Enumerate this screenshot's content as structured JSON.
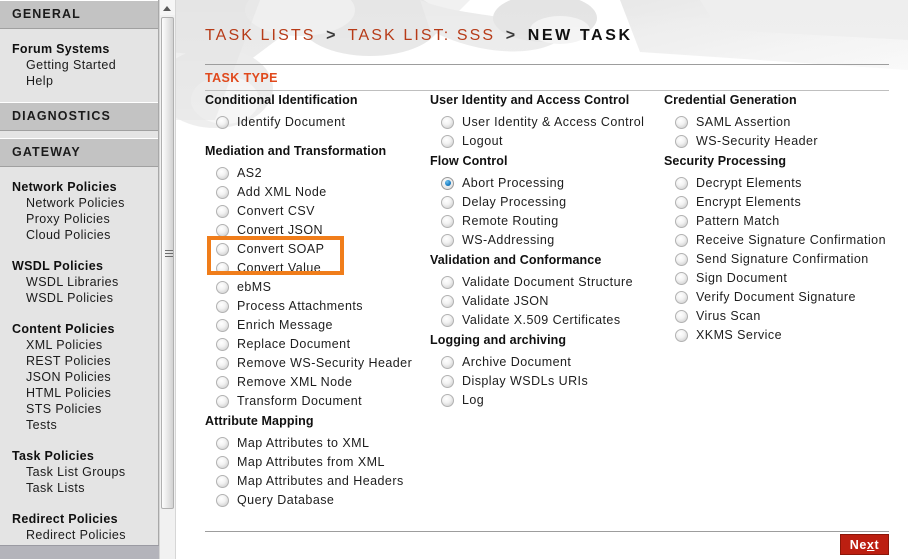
{
  "sidebar": {
    "sections": [
      {
        "header": "GENERAL",
        "groups": [
          {
            "title": "Forum Systems",
            "links": [
              "Getting Started",
              "Help"
            ]
          }
        ]
      },
      {
        "header": "DIAGNOSTICS",
        "groups": []
      },
      {
        "header": "GATEWAY",
        "groups": [
          {
            "title": "Network Policies",
            "links": [
              "Network Policies",
              "Proxy Policies",
              "Cloud Policies"
            ]
          },
          {
            "title": "WSDL Policies",
            "links": [
              "WSDL Libraries",
              "WSDL Policies"
            ]
          },
          {
            "title": "Content Policies",
            "links": [
              "XML Policies",
              "REST Policies",
              "JSON Policies",
              "HTML Policies",
              "STS Policies",
              "Tests"
            ]
          },
          {
            "title": "Task Policies",
            "links": [
              "Task List Groups",
              "Task Lists"
            ]
          },
          {
            "title": "Redirect Policies",
            "links": [
              "Redirect Policies"
            ]
          }
        ]
      }
    ]
  },
  "breadcrumb": {
    "items": [
      "TASK LISTS",
      "TASK LIST: SSS"
    ],
    "separator": ">",
    "current": "NEW TASK"
  },
  "section": {
    "title": "TASK TYPE"
  },
  "columns": [
    {
      "groups": [
        {
          "title": "Conditional Identification",
          "options": [
            {
              "label": "Identify Document",
              "selected": false
            }
          ]
        },
        {
          "title": "Mediation and Transformation",
          "options": [
            {
              "label": "AS2",
              "selected": false
            },
            {
              "label": "Add XML Node",
              "selected": false
            },
            {
              "label": "Convert CSV",
              "selected": false
            },
            {
              "label": "Convert JSON",
              "selected": false
            },
            {
              "label": "Convert SOAP",
              "selected": false
            },
            {
              "label": "Convert Value",
              "selected": false
            },
            {
              "label": "ebMS",
              "selected": false
            },
            {
              "label": "Process Attachments",
              "selected": false
            },
            {
              "label": "Enrich Message",
              "selected": false
            },
            {
              "label": "Replace Document",
              "selected": false
            },
            {
              "label": "Remove WS-Security Header",
              "selected": false
            },
            {
              "label": "Remove XML Node",
              "selected": false
            },
            {
              "label": "Transform Document",
              "selected": false
            }
          ]
        },
        {
          "title": "Attribute Mapping",
          "options": [
            {
              "label": "Map Attributes to XML",
              "selected": false
            },
            {
              "label": "Map Attributes from XML",
              "selected": false
            },
            {
              "label": "Map Attributes and Headers",
              "selected": false
            },
            {
              "label": "Query Database",
              "selected": false
            }
          ]
        }
      ]
    },
    {
      "groups": [
        {
          "title": "User Identity and Access Control",
          "options": [
            {
              "label": "User Identity & Access Control",
              "selected": false
            },
            {
              "label": "Logout",
              "selected": false
            }
          ]
        },
        {
          "title": "Flow Control",
          "options": [
            {
              "label": "Abort Processing",
              "selected": true
            },
            {
              "label": "Delay Processing",
              "selected": false
            },
            {
              "label": "Remote Routing",
              "selected": false
            },
            {
              "label": "WS-Addressing",
              "selected": false
            }
          ]
        },
        {
          "title": "Validation and Conformance",
          "options": [
            {
              "label": "Validate Document Structure",
              "selected": false
            },
            {
              "label": "Validate JSON",
              "selected": false
            },
            {
              "label": "Validate X.509 Certificates",
              "selected": false
            }
          ]
        },
        {
          "title": "Logging and archiving",
          "options": [
            {
              "label": "Archive Document",
              "selected": false
            },
            {
              "label": "Display WSDLs URIs",
              "selected": false
            },
            {
              "label": "Log",
              "selected": false
            }
          ]
        }
      ]
    },
    {
      "groups": [
        {
          "title": "Credential Generation",
          "options": [
            {
              "label": "SAML Assertion",
              "selected": false
            },
            {
              "label": "WS-Security Header",
              "selected": false
            }
          ]
        },
        {
          "title": "Security Processing",
          "options": [
            {
              "label": "Decrypt Elements",
              "selected": false
            },
            {
              "label": "Encrypt Elements",
              "selected": false
            },
            {
              "label": "Pattern Match",
              "selected": false
            },
            {
              "label": "Receive Signature Confirmation",
              "selected": false
            },
            {
              "label": "Send Signature Confirmation",
              "selected": false
            },
            {
              "label": "Sign Document",
              "selected": false
            },
            {
              "label": "Verify Document Signature",
              "selected": false
            },
            {
              "label": "Virus Scan",
              "selected": false
            },
            {
              "label": "XKMS Service",
              "selected": false
            }
          ]
        }
      ]
    }
  ],
  "highlight": {
    "targets": [
      "Convert JSON",
      "Convert SOAP"
    ],
    "color": "#f07d1a"
  },
  "footer": {
    "next_label_before": "Ne",
    "next_label_accesskey": "x",
    "next_label_after": "t",
    "next_label": "Next"
  },
  "colors": {
    "accent_orange": "#e0491c",
    "breadcrumb_link": "#b73b18",
    "next_button": "#bc1f11",
    "sidebar_bg": "#e4e4e4",
    "sidebar_header_bg": "#c3c3c3",
    "radio_selected": "#1f83c9"
  }
}
